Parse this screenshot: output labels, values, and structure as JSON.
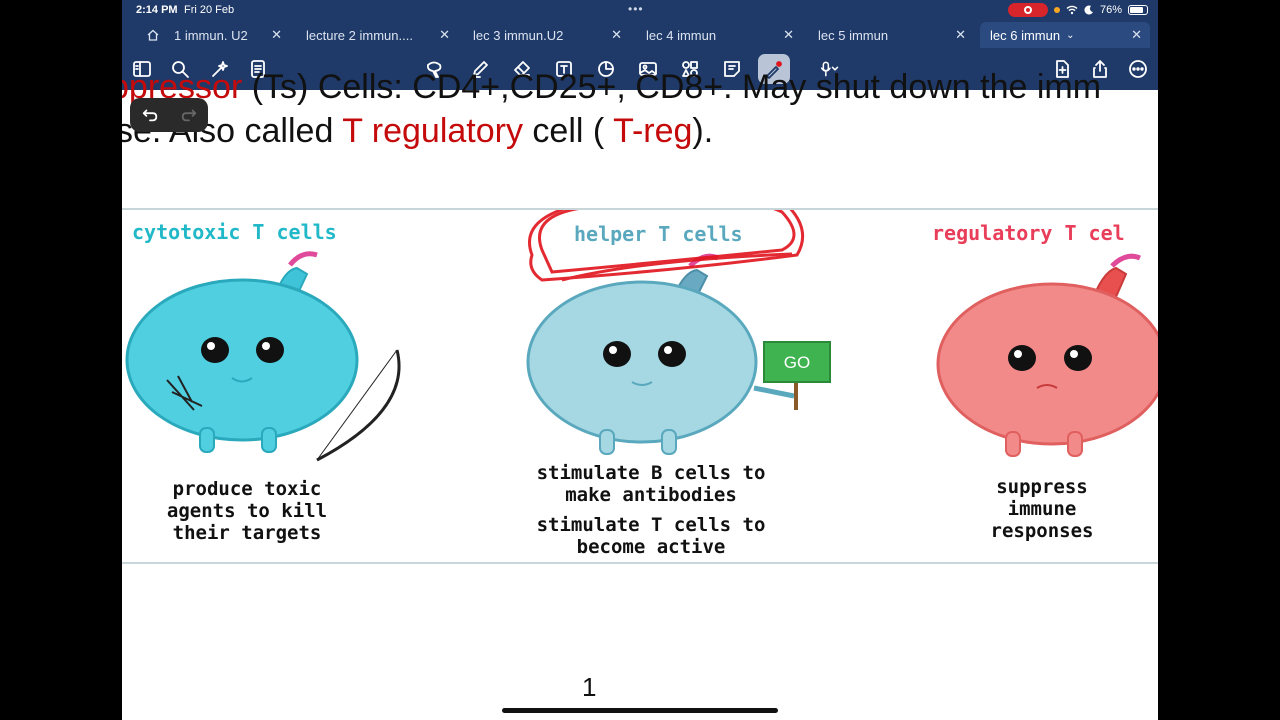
{
  "status_bar": {
    "time": "2:14 PM",
    "date": "Fri 20 Feb",
    "battery": "76%"
  },
  "tabs": [
    {
      "label": "1 immun. U2",
      "active": false
    },
    {
      "label": "lecture 2 immun....",
      "active": false
    },
    {
      "label": "lec 3 immun.U2",
      "active": false
    },
    {
      "label": "lec 4 immun",
      "active": false
    },
    {
      "label": "lec 5 immun",
      "active": false
    },
    {
      "label": "lec 6 immun",
      "active": true
    }
  ],
  "toolbar_icons": [
    "sidebar-icon",
    "search-icon",
    "magic-icon",
    "document-list-icon",
    "lasso-icon",
    "pen-icon",
    "eraser-icon",
    "text-box-icon",
    "shapes-icon",
    "image-icon",
    "elements-icon",
    "sticky-note-icon",
    "laser-pointer-icon",
    "microphone-icon",
    "add-page-icon",
    "share-icon",
    "more-icon"
  ],
  "document": {
    "line1_red": "ppressor",
    "line1_rest": " (Ts) Cells: CD4+,CD25+, CD8+. May shut down the imm",
    "line2_prefix": "se. Also called ",
    "line2_red1": "T regulatory",
    "line2_mid": " cell ( ",
    "line2_red2": "T-reg",
    "line2_suffix": ")."
  },
  "figure": {
    "cells": [
      {
        "title": "cytotoxic T cells",
        "desc": [
          "produce toxic",
          "agents to kill",
          "their targets"
        ],
        "color": "#4fcfe0"
      },
      {
        "title": "helper T cells",
        "desc": [
          "stimulate B cells to",
          "make antibodies",
          "stimulate T cells to",
          "become active"
        ],
        "sign": "GO",
        "color": "#9fd4e0"
      },
      {
        "title": "regulatory T cel",
        "desc": [
          "suppress",
          "immune",
          "responses"
        ],
        "color": "#f28a8a"
      }
    ]
  },
  "page_number": "1",
  "colors": {
    "chrome": "#1f3a68",
    "annotation_red": "#e0141c",
    "title_teal": "#21b8c8",
    "title_red": "#e83e5a"
  }
}
